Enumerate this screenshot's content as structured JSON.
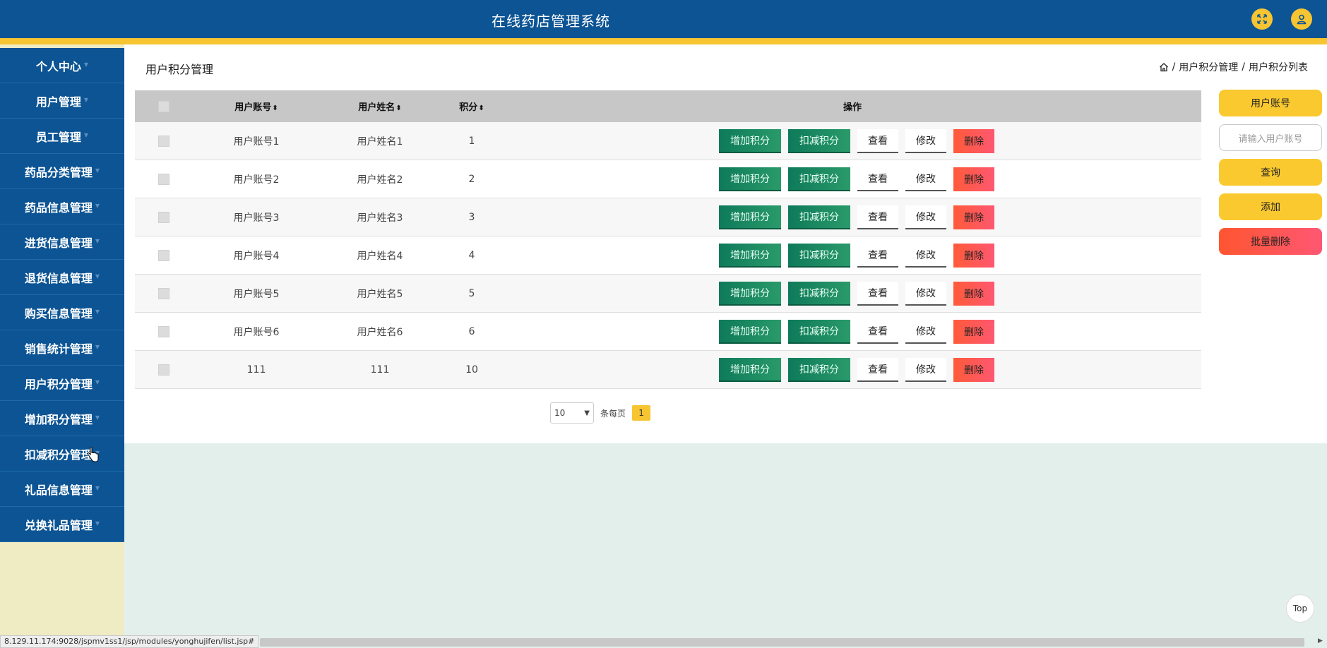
{
  "header": {
    "title": "在线药店管理系统",
    "fullscreen_icon": "expand-arrows-icon",
    "user_icon": "user-icon",
    "colors": {
      "bar": "#0c5494",
      "accent": "#f7c432"
    }
  },
  "sidebar": {
    "items": [
      {
        "label": "个人中心"
      },
      {
        "label": "用户管理"
      },
      {
        "label": "员工管理"
      },
      {
        "label": "药品分类管理"
      },
      {
        "label": "药品信息管理"
      },
      {
        "label": "进货信息管理"
      },
      {
        "label": "退货信息管理"
      },
      {
        "label": "购买信息管理"
      },
      {
        "label": "销售统计管理"
      },
      {
        "label": "用户积分管理"
      },
      {
        "label": "增加积分管理"
      },
      {
        "label": "扣减积分管理"
      },
      {
        "label": "礼品信息管理"
      },
      {
        "label": "兑换礼品管理"
      }
    ]
  },
  "page": {
    "title": "用户积分管理",
    "breadcrumb": [
      "用户积分管理",
      "用户积分列表"
    ],
    "breadcrumb_sep": "/"
  },
  "table": {
    "columns": {
      "account": "用户账号",
      "name": "用户姓名",
      "points": "积分",
      "ops": "操作"
    },
    "rows": [
      {
        "account": "用户账号1",
        "name": "用户姓名1",
        "points": "1"
      },
      {
        "account": "用户账号2",
        "name": "用户姓名2",
        "points": "2"
      },
      {
        "account": "用户账号3",
        "name": "用户姓名3",
        "points": "3"
      },
      {
        "account": "用户账号4",
        "name": "用户姓名4",
        "points": "4"
      },
      {
        "account": "用户账号5",
        "name": "用户姓名5",
        "points": "5"
      },
      {
        "account": "用户账号6",
        "name": "用户姓名6",
        "points": "6"
      },
      {
        "account": "111",
        "name": "111",
        "points": "10"
      }
    ],
    "buttons": {
      "add_points": "增加积分",
      "deduct_points": "扣减积分",
      "view": "查看",
      "edit": "修改",
      "delete": "删除"
    }
  },
  "pagination": {
    "page_size": "10",
    "per_page_label": "条每页",
    "current_page": "1"
  },
  "search": {
    "field_label": "用户账号",
    "placeholder": "请输入用户账号",
    "search_label": "查询",
    "add_label": "添加",
    "batch_delete_label": "批量删除"
  },
  "top_button": "Top",
  "status_url": "8.129.11.174:9028/jspmv1ss1/jsp/modules/yonghujifen/list.jsp#"
}
